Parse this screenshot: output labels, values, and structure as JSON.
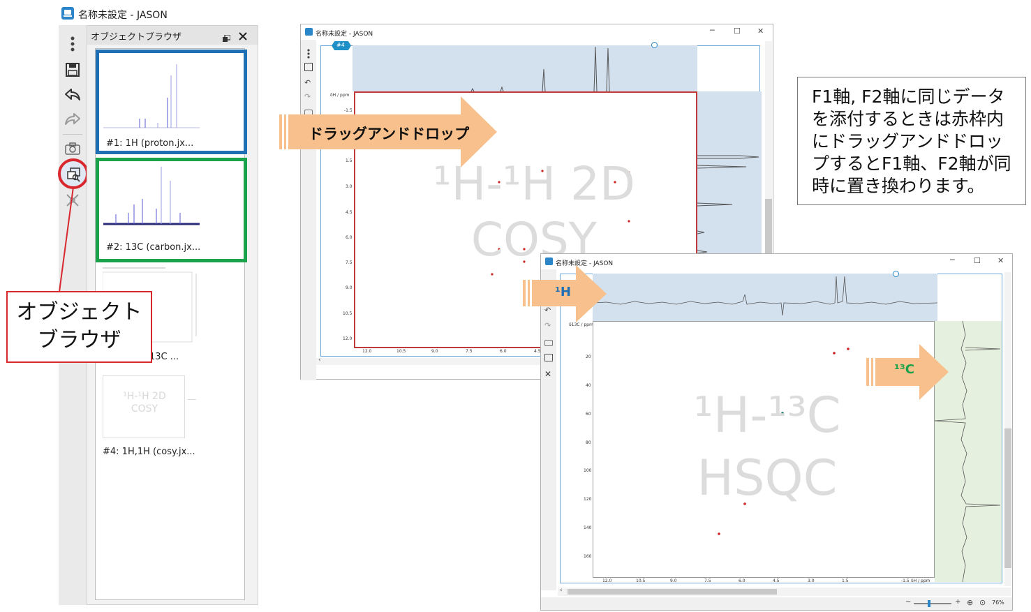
{
  "main_window": {
    "title": "名称未設定 - JASON"
  },
  "object_browser": {
    "title": "オブジェクトブラウザ",
    "items": [
      {
        "label": "#1: 1H (proton.jx..."
      },
      {
        "label": "#2: 13C (carbon.jx..."
      },
      {
        "label": "13C ..."
      },
      {
        "label": "#4: 1H,1H (cosy.jx..."
      }
    ],
    "thumb4_watermark": [
      "¹H-¹H 2D",
      "COSY"
    ]
  },
  "callout": {
    "text": "オブジェクト\nブラウザ"
  },
  "cosy_window": {
    "title": "名称未設定 - JASON",
    "badge": "#4",
    "y_axis_label": "δH / ppm",
    "y_ticks": [
      "-1.5",
      "1.5",
      "3.0",
      "4.5",
      "6.0",
      "7.5",
      "9.0",
      "10.5",
      "12.0"
    ],
    "x_ticks": [
      "12.0",
      "10.5",
      "9.0",
      "7.5",
      "6.0",
      "4.5"
    ],
    "watermark_line1": "¹H-¹H 2D",
    "watermark_line2": "COSY"
  },
  "drag_arrow": {
    "label": "ドラッグアンドドロップ"
  },
  "note_box": {
    "text": "F1軸, F2軸に同じデータを添付するときは赤枠内にドラッグアンドドロップするとF1軸、F2軸が同時に置き換わります。"
  },
  "hsqc_window": {
    "title": "名称未設定 - JASON",
    "y_axis_label": "δ13C / ppm",
    "y_ticks": [
      "20",
      "40",
      "60",
      "80",
      "100",
      "120",
      "140",
      "160"
    ],
    "x_ticks": [
      "12.0",
      "10.5",
      "9.0",
      "7.5",
      "6.0",
      "4.5",
      "3.0",
      "1.5",
      "-1.5"
    ],
    "x_axis_label": "δH / ppm",
    "watermark_line1": "¹H-¹³C",
    "watermark_line2": "HSQC",
    "zoom": "76%"
  },
  "arrow_1h": {
    "label": "¹H"
  },
  "arrow_13c": {
    "label": "¹³C"
  },
  "colors": {
    "blue_frame": "#1f6fb5",
    "green_frame": "#1aa34a",
    "red_callout": "#d9272e",
    "arrow_orange": "#f7c08c",
    "label_1h": "#1f6fb5",
    "label_13c": "#1aa34a"
  }
}
